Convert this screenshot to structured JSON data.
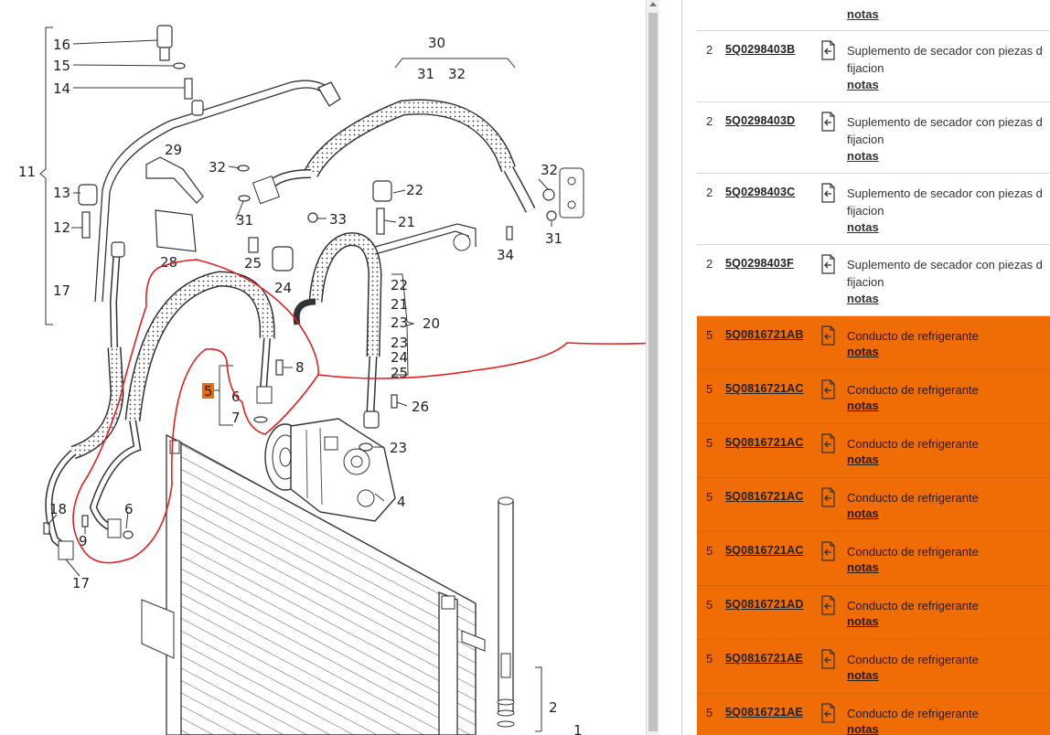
{
  "diagram": {
    "callouts": [
      "30",
      "31",
      "32",
      "16",
      "15",
      "14",
      "11",
      "13",
      "12",
      "17",
      "29",
      "32",
      "22",
      "31",
      "33",
      "21",
      "28",
      "25",
      "24",
      "22",
      "21",
      "23",
      "20",
      "23",
      "24",
      "25",
      "8",
      "5",
      "6",
      "7",
      "26",
      "23",
      "4",
      "32",
      "31",
      "34",
      "18",
      "9",
      "6",
      "17",
      "2",
      "1"
    ],
    "highlighted_callout": "5"
  },
  "parts": {
    "top_partial_note": "notas",
    "rows": [
      {
        "qty": "2",
        "part_no": "5Q0298403B",
        "desc_line1": "Suplemento de secador con piezas d",
        "desc_line2": "fijacion",
        "note": "notas",
        "highlighted": false
      },
      {
        "qty": "2",
        "part_no": "5Q0298403D",
        "desc_line1": "Suplemento de secador con piezas d",
        "desc_line2": "fijacion",
        "note": "notas",
        "highlighted": false
      },
      {
        "qty": "2",
        "part_no": "5Q0298403C",
        "desc_line1": "Suplemento de secador con piezas d",
        "desc_line2": "fijacion",
        "note": "notas",
        "highlighted": false
      },
      {
        "qty": "2",
        "part_no": "5Q0298403F",
        "desc_line1": "Suplemento de secador con piezas d",
        "desc_line2": "fijacion",
        "note": "notas",
        "highlighted": false
      },
      {
        "qty": "5",
        "part_no": "5Q0816721AB",
        "desc_line1": "Conducto de refrigerante",
        "desc_line2": "",
        "note": "notas",
        "highlighted": true
      },
      {
        "qty": "5",
        "part_no": "5Q0816721AC",
        "desc_line1": "Conducto de refrigerante",
        "desc_line2": "",
        "note": "notas",
        "highlighted": true
      },
      {
        "qty": "5",
        "part_no": "5Q0816721AC",
        "desc_line1": "Conducto de refrigerante",
        "desc_line2": "",
        "note": "notas",
        "highlighted": true
      },
      {
        "qty": "5",
        "part_no": "5Q0816721AC",
        "desc_line1": "Conducto de refrigerante",
        "desc_line2": "",
        "note": "notas",
        "highlighted": true
      },
      {
        "qty": "5",
        "part_no": "5Q0816721AC",
        "desc_line1": "Conducto de refrigerante",
        "desc_line2": "",
        "note": "notas",
        "highlighted": true
      },
      {
        "qty": "5",
        "part_no": "5Q0816721AD",
        "desc_line1": "Conducto de refrigerante",
        "desc_line2": "",
        "note": "notas",
        "highlighted": true
      },
      {
        "qty": "5",
        "part_no": "5Q0816721AE",
        "desc_line1": "Conducto de refrigerante",
        "desc_line2": "",
        "note": "notas",
        "highlighted": true
      },
      {
        "qty": "5",
        "part_no": "5Q0816721AE",
        "desc_line1": "Conducto de refrigerante",
        "desc_line2": "",
        "note": "notas",
        "highlighted": true
      }
    ]
  },
  "colors": {
    "highlight_row": "#f06c05",
    "annotation_red": "#e02020",
    "callout_box": "#f06c05"
  },
  "icons": [
    "document-arrow-icon"
  ]
}
